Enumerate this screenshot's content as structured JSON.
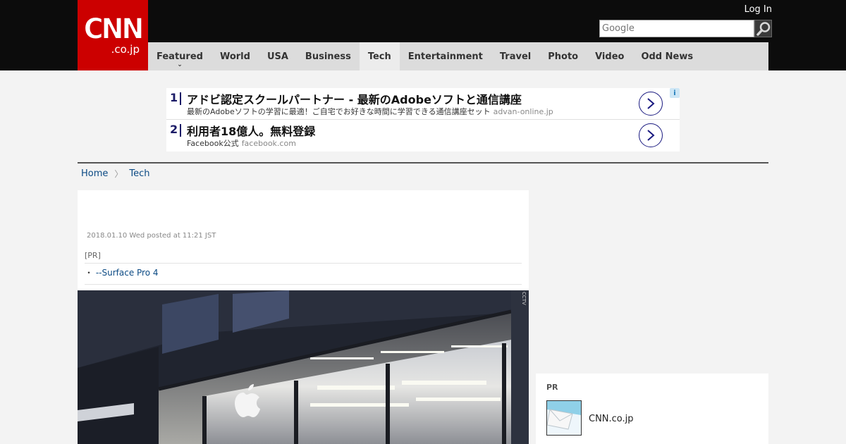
{
  "header": {
    "logo_main": "CNN",
    "logo_sub": ".co.jp",
    "login": "Log In",
    "search_placeholder": "Google"
  },
  "nav": {
    "items": [
      {
        "label": "Featured",
        "has_dropdown": true
      },
      {
        "label": "World"
      },
      {
        "label": "USA"
      },
      {
        "label": "Business"
      },
      {
        "label": "Tech",
        "active": true
      },
      {
        "label": "Entertainment"
      },
      {
        "label": "Travel"
      },
      {
        "label": "Photo"
      },
      {
        "label": "Video"
      },
      {
        "label": "Odd News"
      }
    ],
    "dropdown_icon": "⌄"
  },
  "ads": [
    {
      "num": "1",
      "title": "アドビ認定スクールパートナー - 最新のAdobeソフトと通信講座",
      "desc": "最新のAdobeソフトの学習に最適！ご自宅でお好きな時間に学習できる通信講座セット",
      "domain": "advan-online.jp"
    },
    {
      "num": "2",
      "title": "利用者18億人。無料登録",
      "desc": "Facebook公式",
      "domain": "facebook.com"
    }
  ],
  "ad_info": "i",
  "breadcrumb": {
    "home": "Home",
    "separator": "〉",
    "current": "Tech"
  },
  "article": {
    "date": "2018.01.10 Wed posted at 11:21 JST",
    "pr_label": "[PR]",
    "pr_bullet": "・",
    "pr_link": "--Surface Pro 4"
  },
  "photo_credit": "CCTV",
  "sidebar": {
    "pr_label": "PR",
    "item_text": "CNN.co.jp"
  },
  "colors": {
    "brand_red": "#cc0000",
    "topbar": "#0c0c0c",
    "nav_bg": "#dcdcdc",
    "link": "#0b4a84",
    "page_bg": "#f3f3f3"
  }
}
